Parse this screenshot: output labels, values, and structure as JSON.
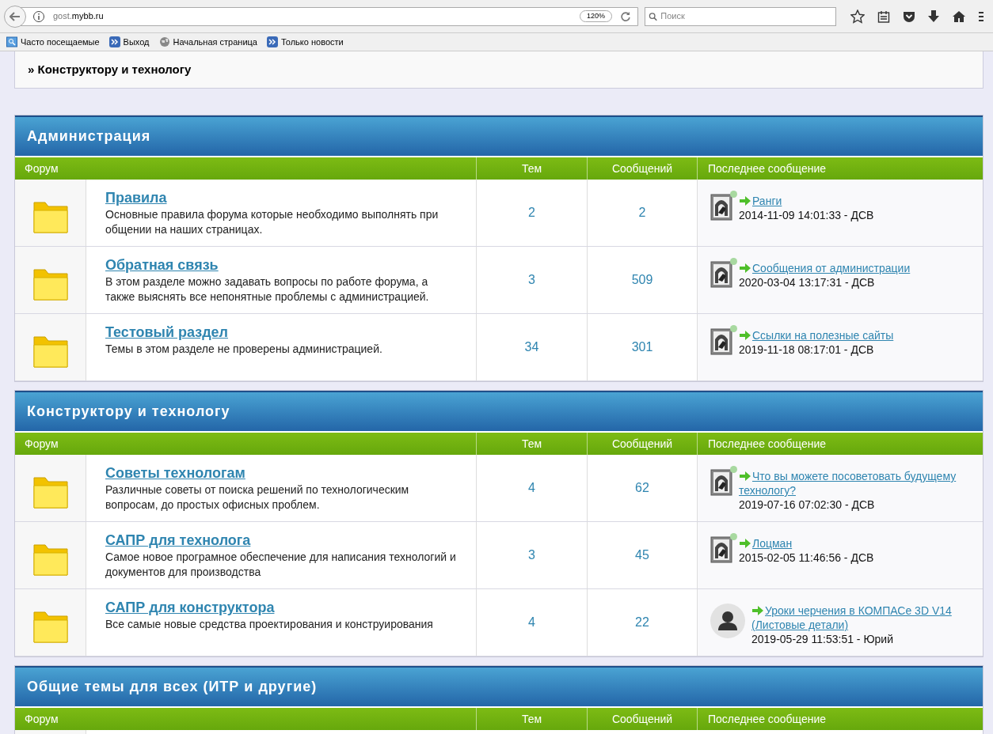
{
  "browser": {
    "url_host": "gost.",
    "url_domain": "mybb.ru",
    "zoom": "120%",
    "search_placeholder": "Поиск"
  },
  "bookmarks": [
    "Часто посещаемые",
    "Выход",
    "Начальная страница",
    "Только новости"
  ],
  "breadcrumb": "» Конструктору и технологу",
  "categories": [
    {
      "title": "Администрация",
      "columns": [
        "Форум",
        "Тем",
        "Сообщений",
        "Последнее сообщение"
      ],
      "forums": [
        {
          "name": "Правила",
          "description": "Основные правила форума которые необходимо выполнять при общении на наших страницах.",
          "topics": "2",
          "posts": "2",
          "last": {
            "kind": "picture",
            "online": true,
            "topic": "Ранги",
            "meta": "2014-11-09 14:01:33 - ДСВ"
          }
        },
        {
          "name": "Обратная связь",
          "description": "В этом разделе можно задавать вопросы по работе форума, а также выяснять все непонятные проблемы с администрацией.",
          "topics": "3",
          "posts": "509",
          "last": {
            "kind": "picture",
            "online": true,
            "topic": "Сообщения от администрации",
            "meta": "2020-03-04 13:17:31 - ДСВ"
          }
        },
        {
          "name": "Тестовый раздел",
          "description": "Темы в этом разделе не проверены администрацией.",
          "topics": "34",
          "posts": "301",
          "last": {
            "kind": "picture",
            "online": true,
            "topic": "Ссылки на полезные сайты",
            "meta": "2019-11-18 08:17:01 - ДСВ"
          }
        }
      ]
    },
    {
      "title": "Конструктору и технологу",
      "columns": [
        "Форум",
        "Тем",
        "Сообщений",
        "Последнее сообщение"
      ],
      "forums": [
        {
          "name": "Советы технологам",
          "description": "Различные советы от поиска решений по технологическим вопросам, до простых офисных проблем.",
          "topics": "4",
          "posts": "62",
          "last": {
            "kind": "picture",
            "online": true,
            "topic": "Что вы можете посоветовать будущему технологу?",
            "meta": "2019-07-16 07:02:30 - ДСВ"
          }
        },
        {
          "name": "САПР для технолога",
          "description": "Самое новое програмное обеспечение для написания технологий и документов для производства",
          "topics": "3",
          "posts": "45",
          "last": {
            "kind": "picture",
            "online": true,
            "topic": "Лоцман",
            "meta": "2015-02-05 11:46:56 - ДСВ"
          }
        },
        {
          "name": "САПР для конструктора",
          "description": "Все самые новые средства проектирования и конструирования",
          "topics": "4",
          "posts": "22",
          "last": {
            "kind": "silhouette",
            "online": false,
            "topic": "Уроки черчения в КОМПАСе 3D V14 (Листовые детали)",
            "meta": "2019-05-29 11:53:51 - Юрий"
          }
        }
      ]
    },
    {
      "title": "Общие темы для всех (ИТР и другие)",
      "columns": [
        "Форум",
        "Тем",
        "Сообщений",
        "Последнее сообщение"
      ]
    }
  ]
}
